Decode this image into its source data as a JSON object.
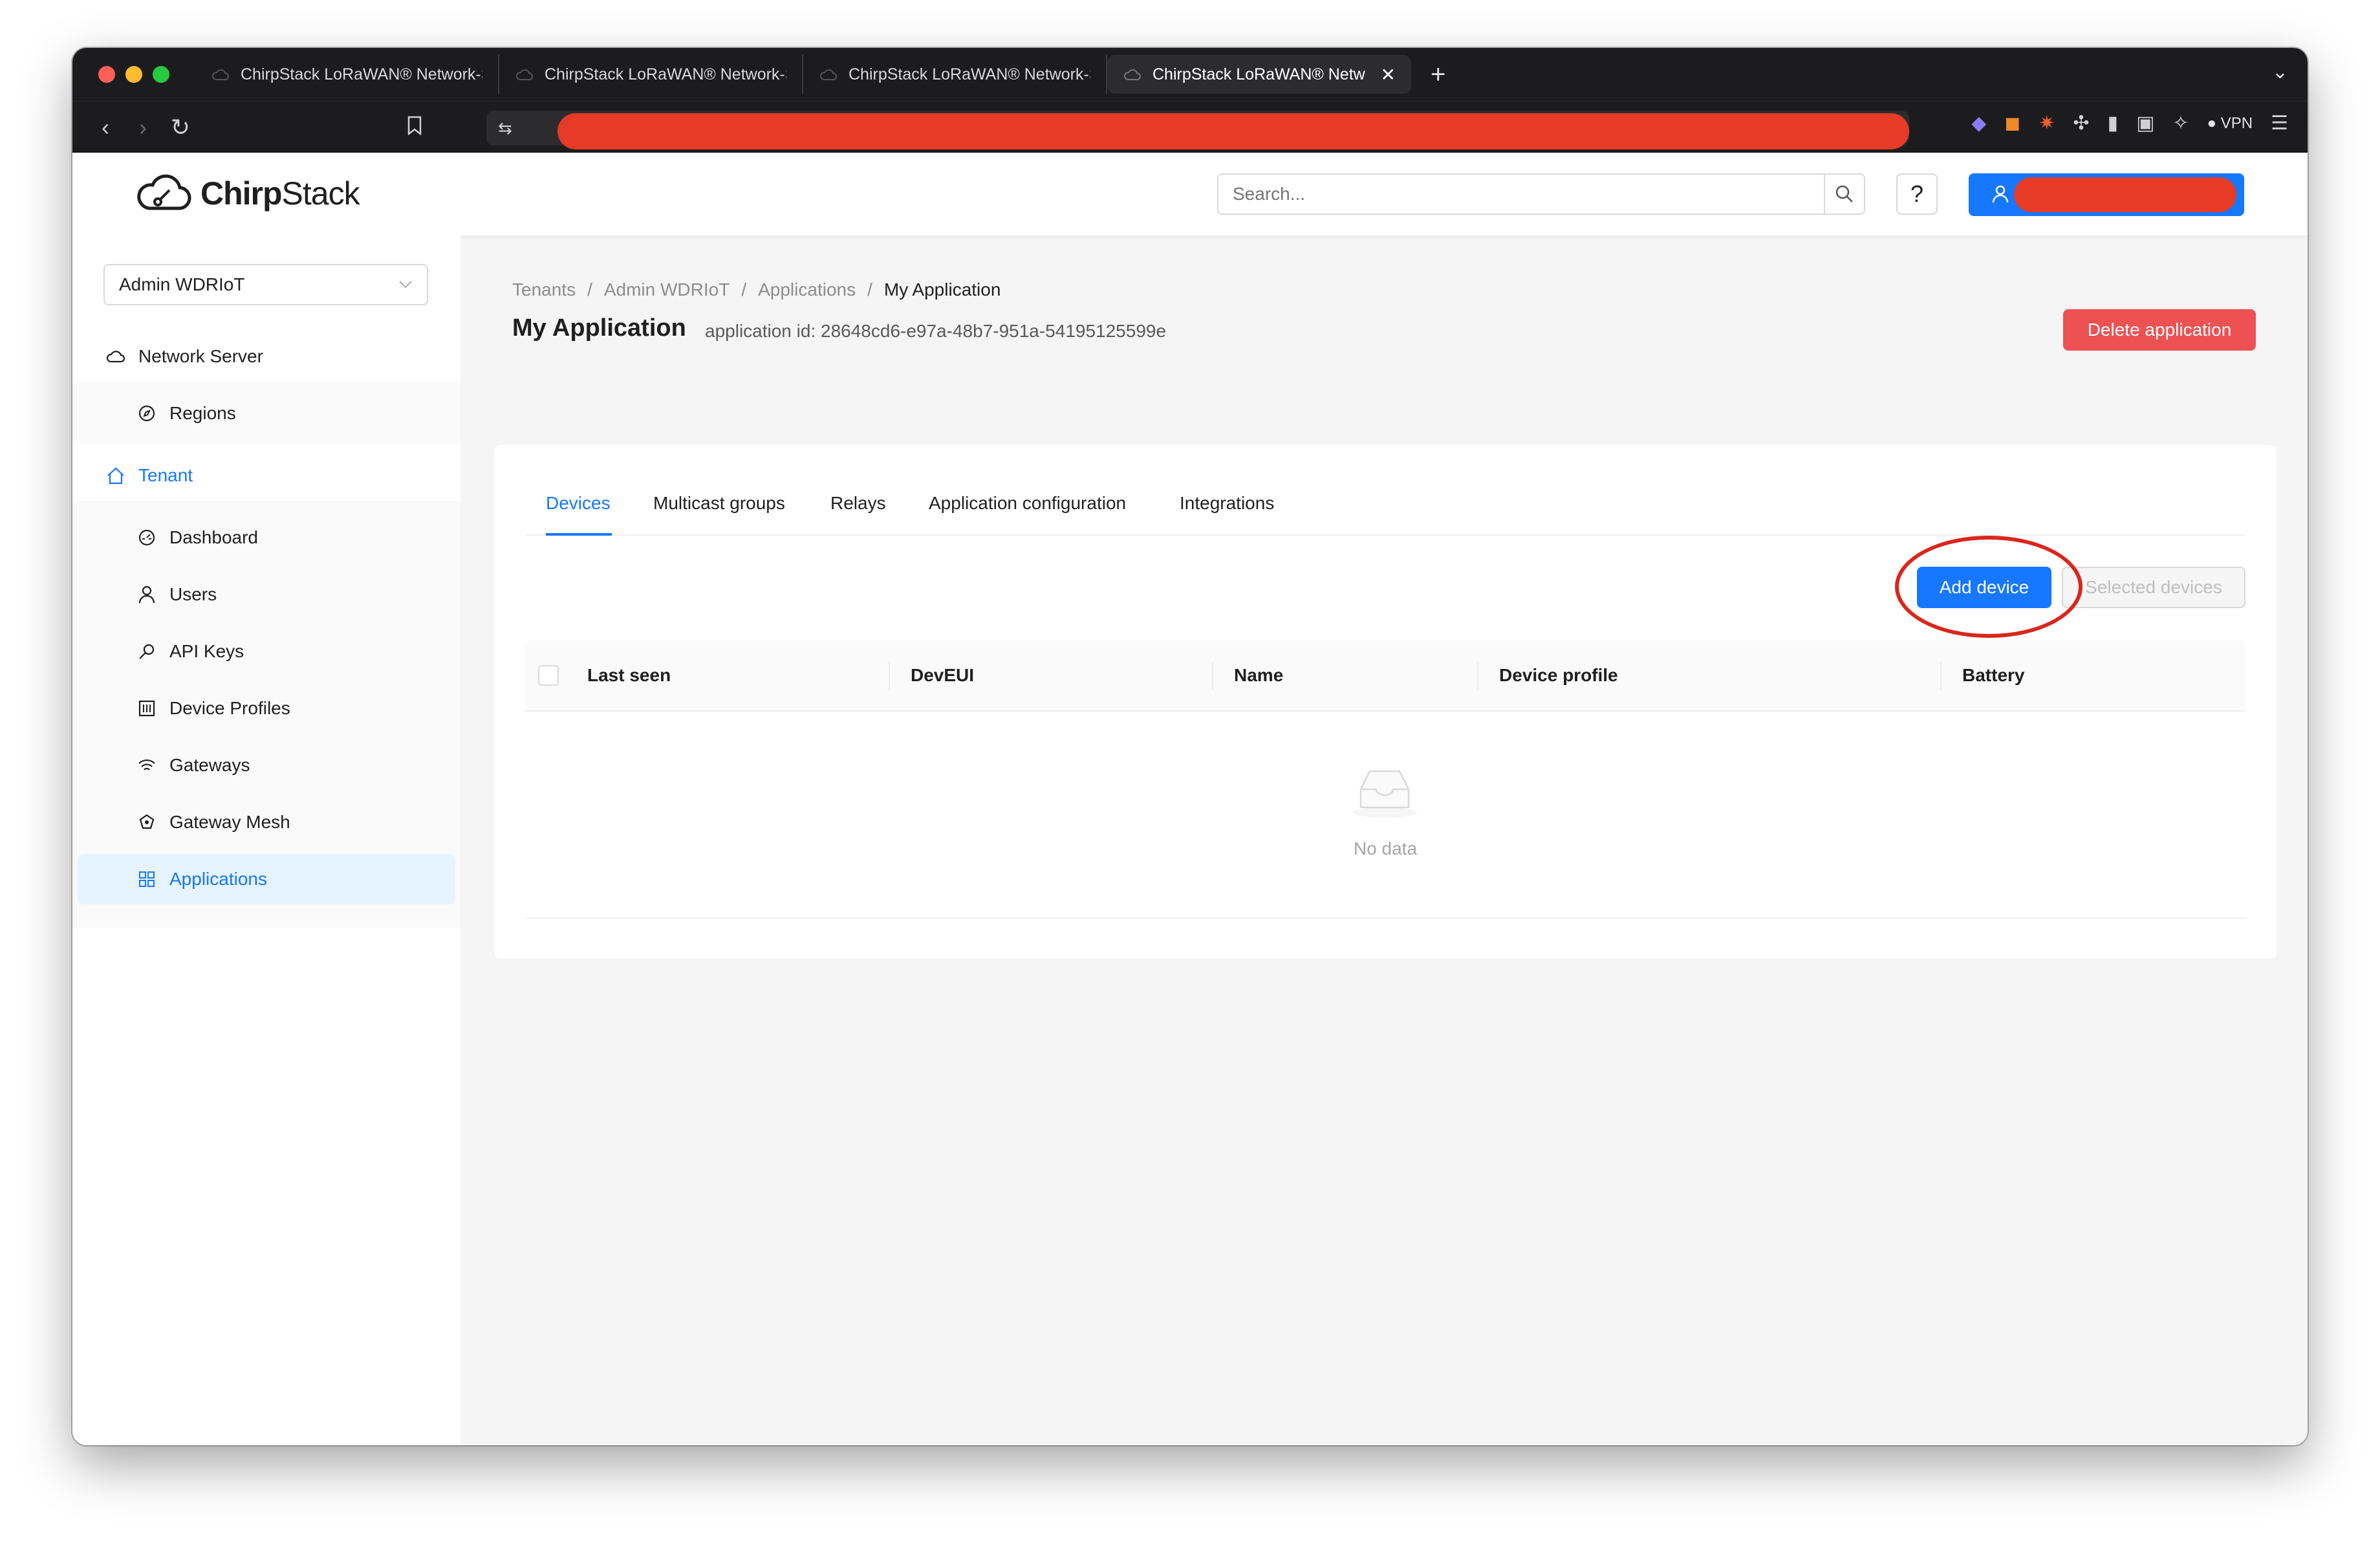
{
  "browser": {
    "tabs": [
      {
        "title": "ChirpStack LoRaWAN® Network-S",
        "active": false
      },
      {
        "title": "ChirpStack LoRaWAN® Network-S",
        "active": false
      },
      {
        "title": "ChirpStack LoRaWAN® Network-S",
        "active": false
      },
      {
        "title": "ChirpStack LoRaWAN® Netw",
        "active": true
      }
    ],
    "new_tab": "+",
    "vpn_label": "VPN"
  },
  "header": {
    "logo_bold": "Chirp",
    "logo_rest": "Stack",
    "search_placeholder": "Search...",
    "help_label": "?"
  },
  "sidebar": {
    "tenant_select": "Admin WDRIoT",
    "items": [
      {
        "label": "Network Server",
        "icon": "cloud-icon"
      },
      {
        "label": "Regions",
        "icon": "compass-icon"
      },
      {
        "label": "Tenant",
        "icon": "home-icon"
      },
      {
        "label": "Dashboard",
        "icon": "dashboard-icon"
      },
      {
        "label": "Users",
        "icon": "user-icon"
      },
      {
        "label": "API Keys",
        "icon": "key-icon"
      },
      {
        "label": "Device Profiles",
        "icon": "control-icon"
      },
      {
        "label": "Gateways",
        "icon": "wifi-icon"
      },
      {
        "label": "Gateway Mesh",
        "icon": "mesh-icon"
      },
      {
        "label": "Applications",
        "icon": "appstore-icon"
      }
    ]
  },
  "breadcrumb": [
    "Tenants",
    "Admin WDRIoT",
    "Applications",
    "My Application"
  ],
  "breadcrumb_sep": "/",
  "page": {
    "title": "My Application",
    "subtitle": "application id: 28648cd6-e97a-48b7-951a-54195125599e",
    "delete_label": "Delete application"
  },
  "tabs": [
    "Devices",
    "Multicast groups",
    "Relays",
    "Application configuration",
    "Integrations"
  ],
  "actions": {
    "add_device": "Add device",
    "selected_devices": "Selected devices"
  },
  "table": {
    "columns": [
      "Last seen",
      "DevEUI",
      "Name",
      "Device profile",
      "Battery"
    ],
    "empty_text": "No data"
  },
  "colors": {
    "primary": "#1677ff",
    "danger": "#ee5151",
    "annotation": "#d9271c",
    "redaction": "#e63b26"
  }
}
